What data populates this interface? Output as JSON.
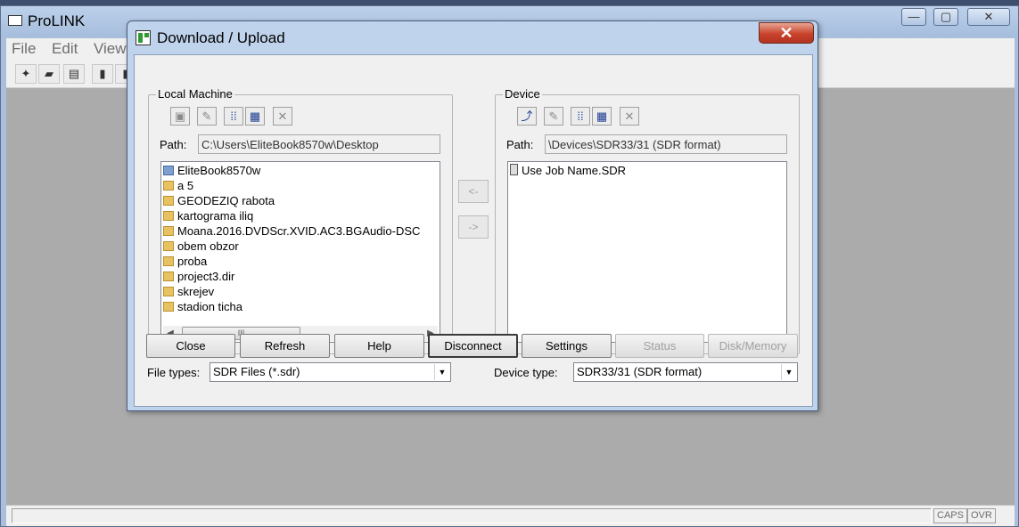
{
  "app": {
    "title": "ProLINK",
    "menu": [
      "File",
      "Edit",
      "View"
    ],
    "window_buttons": {
      "minimize": "—",
      "maximize": "▢",
      "close": "✕"
    },
    "status": {
      "caps": "CAPS",
      "ovr": "OVR"
    }
  },
  "dialog": {
    "title": "Download / Upload",
    "close_glyph": "✕",
    "local": {
      "group_label": "Local Machine",
      "path_label": "Path:",
      "path": "C:\\Users\\EliteBook8570w\\Desktop",
      "files": [
        "EliteBook8570w",
        "a 5",
        "GEODEZIQ rabota",
        "kartograma iliq",
        "Moana.2016.DVDScr.XVID.AC3.BGAudio-DSC",
        "obem obzor",
        "proba",
        "project3.dir",
        "skrejev",
        "stadion ticha"
      ],
      "scroll_left": "◀",
      "scroll_right": "▶",
      "scroll_grip": "III",
      "file_types_label": "File types:",
      "file_types_value": "SDR Files (*.sdr)"
    },
    "device": {
      "group_label": "Device",
      "path_label": "Path:",
      "path": "\\Devices\\SDR33/31 (SDR format)",
      "files": [
        "Use Job Name.SDR"
      ],
      "device_type_label": "Device type:",
      "device_type_value": "SDR33/31 (SDR format)"
    },
    "transfer": {
      "to_local": "<-",
      "to_device": "->"
    },
    "buttons": {
      "close": "Close",
      "refresh": "Refresh",
      "help": "Help",
      "disconnect": "Disconnect",
      "settings": "Settings",
      "status": "Status",
      "disk_memory": "Disk/Memory"
    }
  }
}
